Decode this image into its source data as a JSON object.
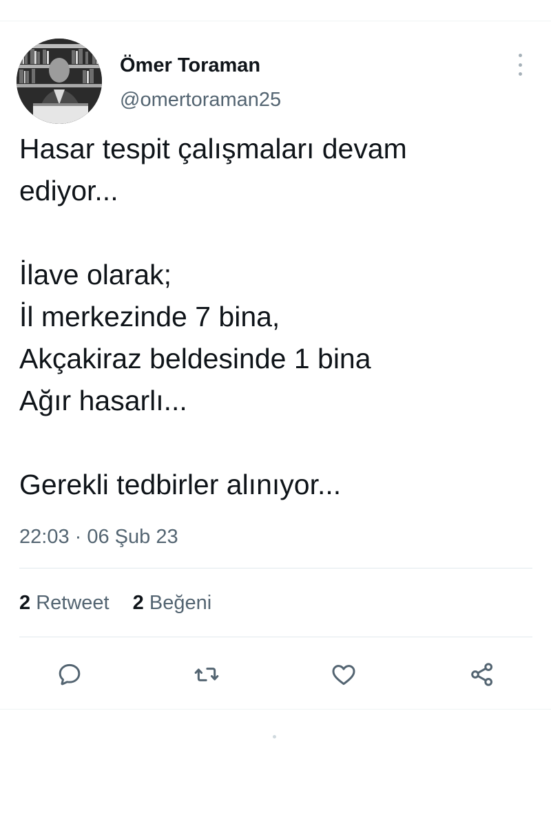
{
  "author": {
    "display_name": "Ömer Toraman",
    "handle": "@omertoraman25"
  },
  "tweet": {
    "lines": [
      "Hasar tespit çalışmaları devam",
      "ediyor...",
      "",
      "İlave olarak;",
      "İl merkezinde 7 bina,",
      "Akçakiraz beldesinde 1 bina",
      "Ağır hasarlı...",
      "",
      "Gerekli tedbirler alınıyor..."
    ],
    "timestamp": "22:03 · 06 Şub 23"
  },
  "stats": {
    "retweets": {
      "count": "2",
      "label": "Retweet"
    },
    "likes": {
      "count": "2",
      "label": "Beğeni"
    }
  },
  "icons": {
    "reply": "reply-icon",
    "retweet": "retweet-icon",
    "like": "heart-icon",
    "share": "share-icon",
    "more": "more-vertical-icon"
  },
  "colors": {
    "text_primary": "#0f1419",
    "text_secondary": "#536471",
    "divider": "#e1e8ed"
  }
}
